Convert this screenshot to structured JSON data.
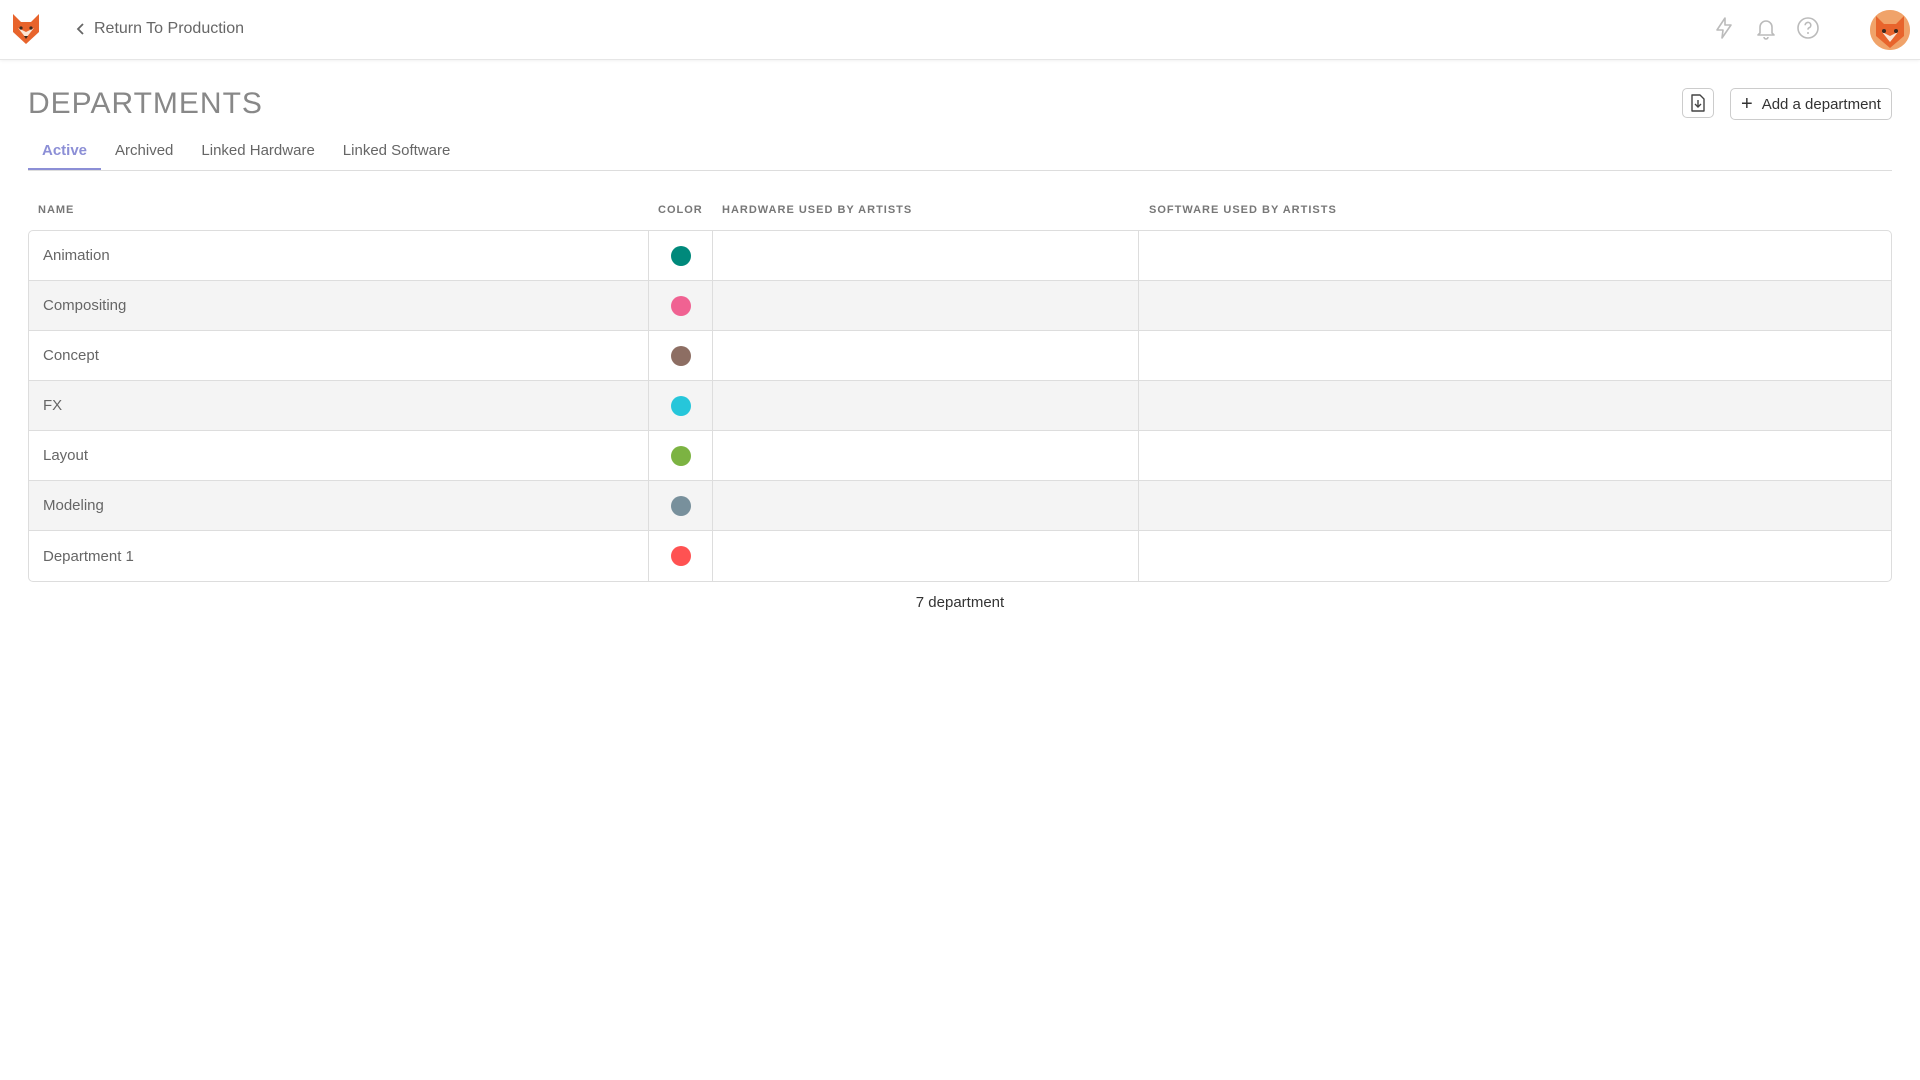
{
  "topbar": {
    "back_label": "Return To Production",
    "icons": [
      "logo-icon",
      "chevron-left-icon",
      "lightning-icon",
      "bell-icon",
      "help-icon",
      "avatar"
    ]
  },
  "page": {
    "title": "DEPARTMENTS",
    "add_button_label": "Add a department"
  },
  "tabs": [
    {
      "label": "Active",
      "active": true
    },
    {
      "label": "Archived",
      "active": false
    },
    {
      "label": "Linked Hardware",
      "active": false
    },
    {
      "label": "Linked Software",
      "active": false
    }
  ],
  "table": {
    "columns": [
      "NAME",
      "COLOR",
      "HARDWARE USED BY ARTISTS",
      "SOFTWARE USED BY ARTISTS"
    ],
    "rows": [
      {
        "name": "Animation",
        "color": "#00897b"
      },
      {
        "name": "Compositing",
        "color": "#f06292"
      },
      {
        "name": "Concept",
        "color": "#8d6e63"
      },
      {
        "name": "FX",
        "color": "#26c6da"
      },
      {
        "name": "Layout",
        "color": "#7cb342"
      },
      {
        "name": "Modeling",
        "color": "#78909c"
      },
      {
        "name": "Department 1",
        "color": "#ff5252"
      }
    ]
  },
  "footer": {
    "count_label": "7 department"
  },
  "colors": {
    "accent": "#8c8fd6",
    "logo_orange": "#e8642c"
  }
}
